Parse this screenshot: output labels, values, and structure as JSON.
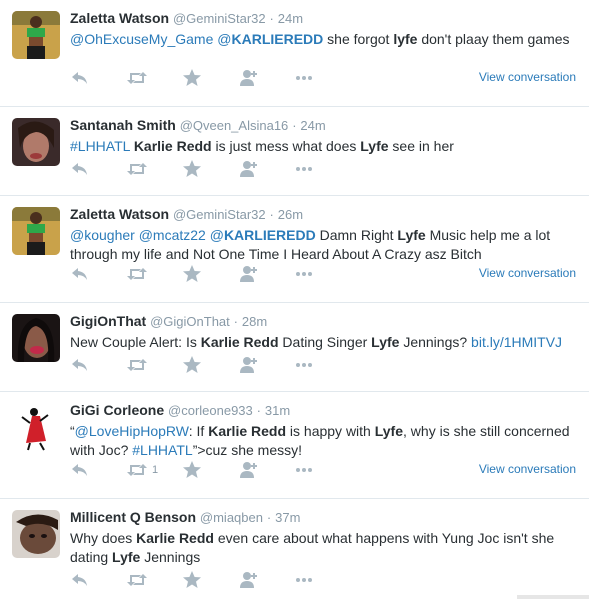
{
  "tweets": [
    {
      "name": "Zaletta Watson",
      "handle": "@GeminiStar32",
      "sep": "·",
      "time": "24m",
      "text": [
        {
          "t": "@OhExcuseMy_Game",
          "c": "link"
        },
        {
          "t": " ",
          "c": ""
        },
        {
          "t": "@",
          "c": "link"
        },
        {
          "t": "KARLIEREDD",
          "c": "linkbold"
        },
        {
          "t": "  she forgot ",
          "c": ""
        },
        {
          "t": "lyfe",
          "c": "bold"
        },
        {
          "t": " don't plaay them games",
          "c": ""
        }
      ],
      "view_conversation": "View conversation",
      "retweet_count": "",
      "avatar": "sports-bra-woman"
    },
    {
      "name": "Santanah Smith",
      "handle": "@Qveen_Alsina16",
      "sep": "·",
      "time": "24m",
      "text": [
        {
          "t": "#LHHATL",
          "c": "link"
        },
        {
          "t": " ",
          "c": ""
        },
        {
          "t": "Karlie Redd",
          "c": "bold"
        },
        {
          "t": " is just mess what does ",
          "c": ""
        },
        {
          "t": "Lyfe",
          "c": "bold"
        },
        {
          "t": " see in her",
          "c": ""
        }
      ],
      "view_conversation": "",
      "retweet_count": "",
      "avatar": "selfie-woman"
    },
    {
      "name": "Zaletta Watson",
      "handle": "@GeminiStar32",
      "sep": "·",
      "time": "26m",
      "text": [
        {
          "t": "@kougher",
          "c": "link"
        },
        {
          "t": " ",
          "c": ""
        },
        {
          "t": "@mcatz22",
          "c": "link"
        },
        {
          "t": " ",
          "c": ""
        },
        {
          "t": "@",
          "c": "link"
        },
        {
          "t": "KARLIEREDD",
          "c": "linkbold"
        },
        {
          "t": "  Damn Right ",
          "c": ""
        },
        {
          "t": "Lyfe",
          "c": "bold"
        },
        {
          "t": " Music help me a lot through my life and Not One Time I Heard About A Crazy asz Bitch",
          "c": ""
        }
      ],
      "view_conversation": "View conversation",
      "retweet_count": "",
      "avatar": "sports-bra-woman"
    },
    {
      "name": "GigiOnThat",
      "handle": "@GigiOnThat",
      "sep": "·",
      "time": "28m",
      "text": [
        {
          "t": "New Couple Alert: Is ",
          "c": ""
        },
        {
          "t": "Karlie Redd",
          "c": "bold"
        },
        {
          "t": " Dating Singer ",
          "c": ""
        },
        {
          "t": "Lyfe",
          "c": "bold"
        },
        {
          "t": " Jennings? ",
          "c": ""
        },
        {
          "t": "bit.ly/1HMITVJ",
          "c": "link"
        }
      ],
      "view_conversation": "",
      "retweet_count": "",
      "avatar": "lips-woman"
    },
    {
      "name": "GiGi Corleone",
      "handle": "@corleone933",
      "sep": "·",
      "time": "31m",
      "text": [
        {
          "t": "“",
          "c": ""
        },
        {
          "t": "@LoveHipHopRW",
          "c": "link"
        },
        {
          "t": ": If ",
          "c": ""
        },
        {
          "t": "Karlie Redd",
          "c": "bold"
        },
        {
          "t": " is happy with ",
          "c": ""
        },
        {
          "t": "Lyfe",
          "c": "bold"
        },
        {
          "t": ", why is she still concerned with Joc? ",
          "c": ""
        },
        {
          "t": "#LHHATL",
          "c": "link"
        },
        {
          "t": "”>cuz she messy!",
          "c": ""
        }
      ],
      "view_conversation": "View conversation",
      "retweet_count": "1",
      "avatar": "red-dress-figure"
    },
    {
      "name": "Millicent Q Benson",
      "handle": "@miaqben",
      "sep": "·",
      "time": "37m",
      "text": [
        {
          "t": "Why does ",
          "c": ""
        },
        {
          "t": "Karlie Redd",
          "c": "bold"
        },
        {
          "t": " even care about what happens with Yung Joc isn't she dating ",
          "c": ""
        },
        {
          "t": "Lyfe",
          "c": "bold"
        },
        {
          "t": " Jennings",
          "c": ""
        }
      ],
      "view_conversation": "",
      "retweet_count": "",
      "avatar": "face-closeup"
    }
  ],
  "icons": [
    "reply-icon",
    "retweet-icon",
    "favorite-icon",
    "follow-icon",
    "more-icon"
  ]
}
